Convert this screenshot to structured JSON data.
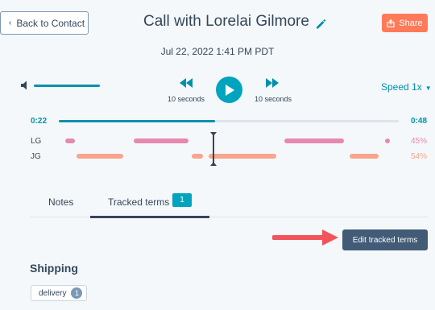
{
  "header": {
    "back_label": "Back to Contact",
    "title": "Call with Lorelai Gilmore",
    "share_label": "Share",
    "date": "Jul 22, 2022 1:41 PM PDT"
  },
  "player": {
    "rewind_label": "10 seconds",
    "forward_label": "10 seconds",
    "speed_label": "Speed 1x",
    "volume_level": 1.0,
    "current_time": "0:22",
    "total_time": "0:48",
    "progress": 0.46
  },
  "speakers": [
    {
      "label": "LG",
      "percent": "45%",
      "color": "#e589b1"
    },
    {
      "label": "JG",
      "percent": "54%",
      "color": "#f7a58d"
    }
  ],
  "tabs": {
    "notes_label": "Notes",
    "tracked_label": "Tracked terms",
    "tracked_count": "1"
  },
  "actions": {
    "edit_terms_label": "Edit tracked terms"
  },
  "shipping": {
    "heading": "Shipping",
    "term_label": "delivery",
    "term_count": "1"
  },
  "colors": {
    "accent": "#0091ae",
    "share": "#ff7a59",
    "arrow": "#f2545b",
    "edit_button": "#425b76"
  }
}
